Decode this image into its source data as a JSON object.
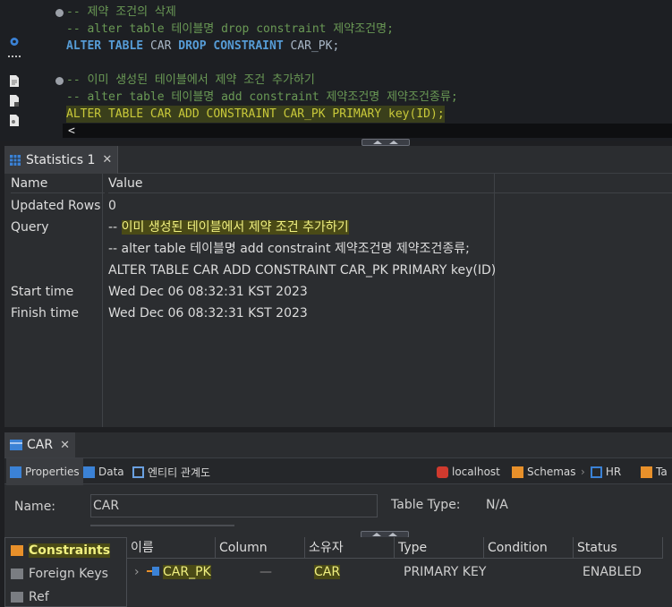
{
  "editor": {
    "lines": [
      {
        "text": "-- 제약 조건의 삭제"
      },
      {
        "text": "-- alter table 테이블명 drop constraint 제약조건명;"
      },
      {
        "kw1": "ALTER",
        "kw2": "TABLE",
        "id1": "CAR",
        "kw3": "DROP",
        "kw4": "CONSTRAINT",
        "id2": "CAR_PK;"
      },
      {
        "text": "-- 이미 생성된 테이블에서 제약 조건 추가하기"
      },
      {
        "text": "-- alter table 테이블명 add constraint 제약조건명 제약조건종류;"
      },
      {
        "text": "ALTER TABLE CAR ADD CONSTRAINT CAR_PK PRIMARY key(ID);"
      }
    ],
    "scroll_marker": "<"
  },
  "statistics": {
    "tab_label": "Statistics 1",
    "close_glyph": "✕",
    "columns": [
      "Name",
      "Value"
    ],
    "rows": [
      {
        "name": "Updated Rows",
        "value": "0"
      },
      {
        "name": "Query",
        "value_prefix": "-- ",
        "value_highlight": "이미 생성된 테이블에서 제약 조건 추가하기"
      },
      {
        "name": "",
        "value": "-- alter table 테이블명 add constraint 제약조건명 제약조건종류;"
      },
      {
        "name": "",
        "value": "ALTER TABLE CAR ADD CONSTRAINT CAR_PK PRIMARY key(ID)"
      },
      {
        "name": "Start time",
        "value": "Wed Dec 06 08:32:31 KST 2023"
      },
      {
        "name": "Finish time",
        "value": "Wed Dec 06 08:32:31 KST 2023"
      }
    ]
  },
  "car_editor": {
    "tab_label": "CAR",
    "close_glyph": "✕",
    "toolbar": {
      "properties": "Properties",
      "data": "Data",
      "er": "엔티티 관계도",
      "connection": "localhost",
      "schemas": "Schemas",
      "schema_name": "HR",
      "tables_partial": "Ta"
    },
    "name_label": "Name:",
    "name_value": "CAR",
    "table_type_label": "Table Type:",
    "table_type_value": "N/A",
    "sidebar": [
      {
        "label": "Constraints"
      },
      {
        "label": "Foreign Keys"
      },
      {
        "label": "Ref"
      }
    ],
    "columns": [
      "이름",
      "Column",
      "소유자",
      "Type",
      "Condition",
      "Status"
    ],
    "row": {
      "name": "CAR_PK",
      "column": "—",
      "owner": "CAR",
      "type": "PRIMARY KEY",
      "condition": "",
      "status": "ENABLED"
    }
  },
  "colors": {
    "comment": "#6a9955",
    "keyword": "#569cd6",
    "highlight_text": "#f0f080"
  }
}
